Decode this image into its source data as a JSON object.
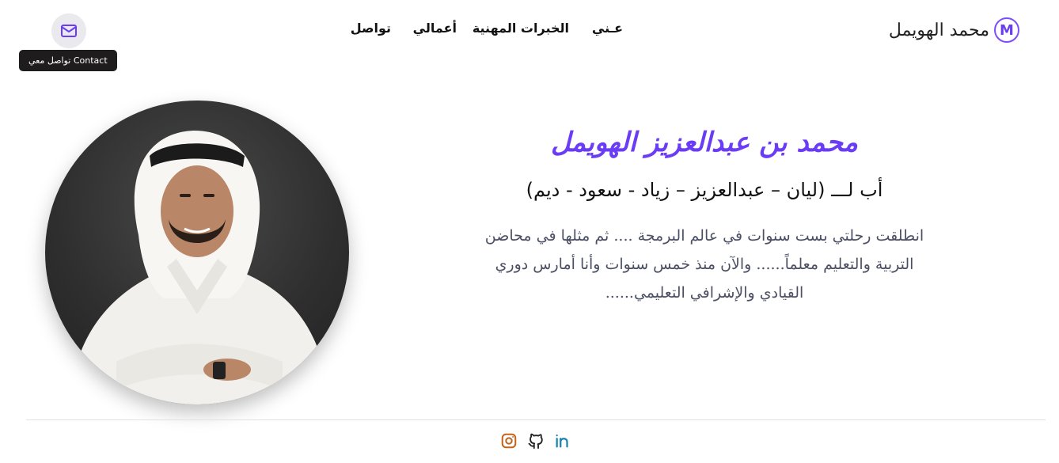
{
  "header": {
    "logo_letter": "M",
    "logo_text": "محمد الهويمل",
    "nav": [
      {
        "label": "عـني"
      },
      {
        "label": "الخبرات المهنية"
      },
      {
        "label": "أعمالي"
      },
      {
        "label": "تواصل"
      }
    ],
    "contact_tooltip": "تواصل معي Contact"
  },
  "hero": {
    "name": "محمد بن عبدالعزيز الهويمل",
    "kids": "أب لـــ (ليان – عبدالعزيز – زياد - سعود - ديم)",
    "bio": "انطلقت رحلتي بست سنوات في عالم البرمجة .... ثم مثلها في محاضن التربية والتعليم معلماً...... والآن منذ خمس سنوات وأنا أمارس دوري القيادي والإشرافي التعليمي......"
  },
  "colors": {
    "accent": "#6b3cf5",
    "instagram": "#c0651d",
    "linkedin": "#1282b0"
  },
  "icons": {
    "contact": "mail-icon",
    "socials": [
      "instagram-icon",
      "github-icon",
      "linkedin-icon"
    ]
  }
}
